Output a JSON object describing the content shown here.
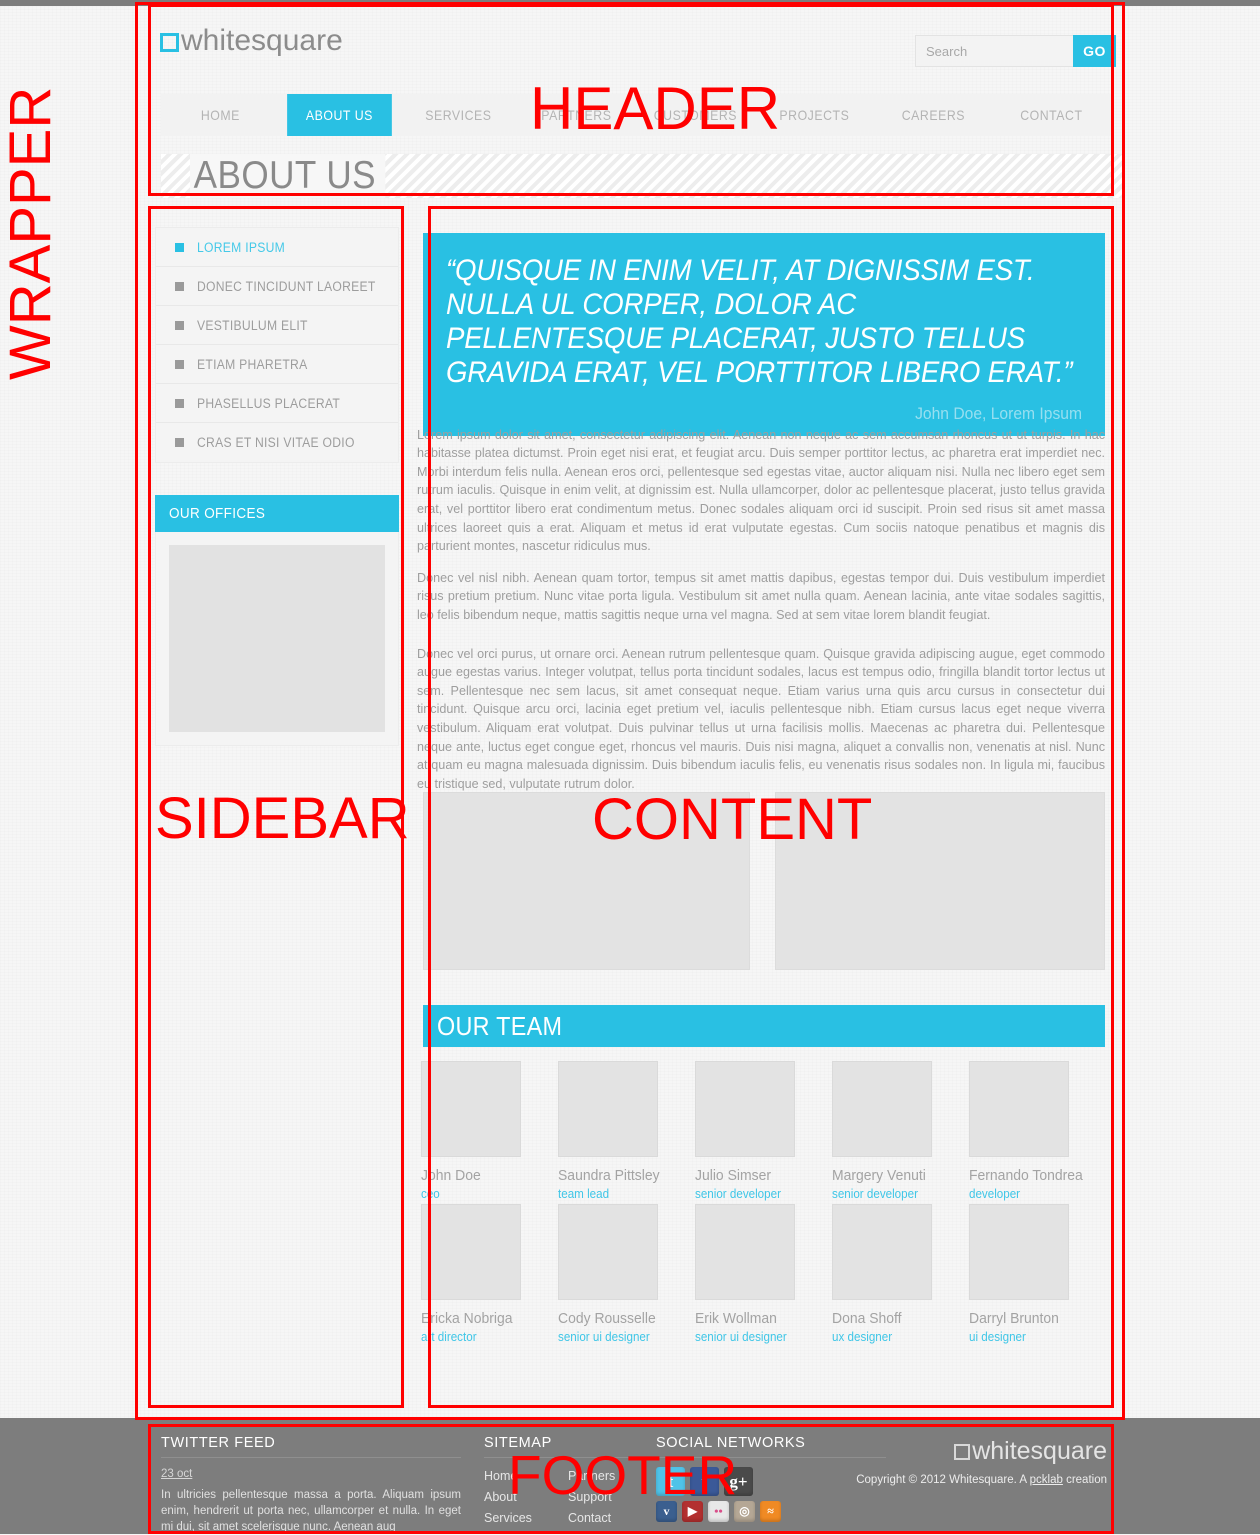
{
  "header": {
    "logo_text": "whitesquare",
    "search": {
      "placeholder": "Search",
      "value": "",
      "button_label": "GO"
    },
    "nav": [
      {
        "label": "HOME",
        "active": false
      },
      {
        "label": "ABOUT US",
        "active": true
      },
      {
        "label": "SERVICES",
        "active": false
      },
      {
        "label": "PARTNERS",
        "active": false
      },
      {
        "label": "CUSTOMERS",
        "active": false
      },
      {
        "label": "PROJECTS",
        "active": false
      },
      {
        "label": "CAREERS",
        "active": false
      },
      {
        "label": "CONTACT",
        "active": false
      }
    ],
    "page_title": "ABOUT US"
  },
  "sidebar": {
    "nav": [
      {
        "label": "LOREM IPSUM",
        "active": true
      },
      {
        "label": "DONEC TINCIDUNT LAOREET",
        "active": false
      },
      {
        "label": "VESTIBULUM ELIT",
        "active": false
      },
      {
        "label": "ETIAM PHARETRA",
        "active": false
      },
      {
        "label": "PHASELLUS PLACERAT",
        "active": false
      },
      {
        "label": "CRAS ET NISI VITAE ODIO",
        "active": false
      }
    ],
    "offices_title": "OUR OFFICES"
  },
  "content": {
    "quote_text": "“QUISQUE IN ENIM VELIT, AT DIGNISSIM EST. NULLA UL CORPER, DOLOR AC PELLENTESQUE PLACERAT, JUSTO TELLUS GRAVIDA ERAT, VEL PORTTITOR LIBERO ERAT.”",
    "quote_author": "John Doe, Lorem Ipsum",
    "paragraph_1": "Lorem ipsum dolor sit amet, consectetur adipiscing elit. Aenean non neque ac sem accumsan rhoncus ut ut turpis. In hac habitasse platea dictumst. Proin eget nisi erat, et feugiat arcu. Duis semper porttitor lectus, ac pharetra erat imperdiet nec. Morbi interdum felis nulla. Aenean eros orci, pellentesque sed egestas vitae, auctor aliquam nisi. Nulla nec libero eget sem rutrum iaculis. Quisque in enim velit, at dignissim est. Nulla ullamcorper, dolor ac pellentesque placerat, justo tellus gravida erat, vel porttitor libero erat condimentum metus. Donec sodales aliquam orci id suscipit. Proin sed risus sit amet massa ultrices laoreet quis a erat. Aliquam et metus id erat vulputate egestas. Cum sociis natoque penatibus et magnis dis parturient montes, nascetur ridiculus mus.",
    "paragraph_2": "Donec vel nisl nibh. Aenean quam tortor, tempus sit amet mattis dapibus, egestas tempor dui. Duis vestibulum imperdiet risus pretium pretium. Nunc vitae porta ligula. Vestibulum sit amet nulla quam. Aenean lacinia, ante vitae sodales sagittis, leo felis bibendum neque, mattis sagittis neque urna vel magna. Sed at sem vitae lorem blandit feugiat.",
    "paragraph_3": "Donec vel orci purus, ut ornare orci. Aenean rutrum pellentesque quam. Quisque gravida adipiscing augue, eget commodo augue egestas varius. Integer volutpat, tellus porta tincidunt sodales, lacus est tempus odio, fringilla blandit tortor lectus ut sem. Pellentesque nec sem lacus, sit amet consequat neque. Etiam varius urna quis arcu cursus in consectetur dui tincidunt. Quisque arcu orci, lacinia eget pretium vel, iaculis pellentesque nibh. Etiam cursus lacus eget neque viverra vestibulum. Aliquam erat volutpat. Duis pulvinar tellus ut urna facilisis mollis. Maecenas ac pharetra dui. Pellentesque neque ante, luctus eget congue eget, rhoncus vel mauris. Duis nisi magna, aliquet a convallis non, venenatis at nisl. Nunc at quam eu magna malesuada dignissim. Duis bibendum iaculis felis, eu venenatis risus sodales non. In ligula mi, faucibus eu tristique sed, vulputate rutrum dolor.",
    "team_title": "OUR TEAM",
    "team": [
      {
        "name": "John Doe",
        "role": "ceo"
      },
      {
        "name": "Saundra Pittsley",
        "role": "team lead"
      },
      {
        "name": "Julio Simser",
        "role": "senior developer"
      },
      {
        "name": "Margery Venuti",
        "role": "senior developer"
      },
      {
        "name": "Fernando Tondrea",
        "role": "developer"
      },
      {
        "name": "Ericka Nobriga",
        "role": "art director"
      },
      {
        "name": "Cody Rousselle",
        "role": "senior ui designer"
      },
      {
        "name": "Erik Wollman",
        "role": "senior ui designer"
      },
      {
        "name": "Dona Shoff",
        "role": "ux designer"
      },
      {
        "name": "Darryl Brunton",
        "role": "ui designer"
      }
    ]
  },
  "footer": {
    "twitter_title": "TWITTER FEED",
    "twitter_date": "23 oct",
    "twitter_text": "In ultricies pellentesque massa a porta. Aliquam ipsum enim, hendrerit ut porta nec, ullamcorper et nulla. In eget mi dui, sit amet scelerisque nunc. Aenean aug",
    "sitemap_title": "SITEMAP",
    "sitemap_col1": [
      "Home",
      "About",
      "Services"
    ],
    "sitemap_col2": [
      "Partners",
      "Support",
      "Contact"
    ],
    "social_title": "SOCIAL NETWORKS",
    "social_row1": [
      {
        "name": "twitter-icon",
        "glyph": "t",
        "color": "#4fc3e8"
      },
      {
        "name": "facebook-icon",
        "glyph": "f",
        "color": "#3b5998"
      },
      {
        "name": "google-plus-icon",
        "glyph": "g+",
        "color": "#4a4a4a"
      }
    ],
    "social_row2": [
      {
        "name": "vimeo-icon",
        "glyph": "v",
        "color": "#3b5f8f"
      },
      {
        "name": "youtube-icon",
        "glyph": "▶",
        "color": "#b33030"
      },
      {
        "name": "flickr-icon",
        "glyph": "••",
        "color": "#e8e8e8"
      },
      {
        "name": "instagram-icon",
        "glyph": "◎",
        "color": "#b5a795"
      },
      {
        "name": "rss-icon",
        "glyph": "≈",
        "color": "#f08a24"
      }
    ],
    "logo_text": "whitesquare",
    "copyright_prefix": "Copyright © 2012 Whitesquare. A ",
    "copyright_link": "pcklab",
    "copyright_suffix": " creation"
  },
  "annotations": {
    "header": "HEADER",
    "wrapper": "WRAPPER",
    "sidebar": "SIDEBAR",
    "content": "CONTENT",
    "footer": "FOOTER"
  },
  "colors": {
    "accent": "#29c0e3",
    "annotation": "#ff0000",
    "footer_bg": "#7d7d7d",
    "text_gray": "#9e9e9e"
  }
}
